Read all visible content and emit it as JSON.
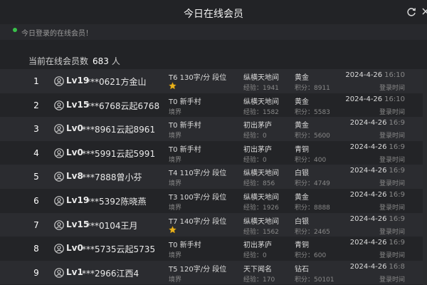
{
  "header": {
    "title": "今日在线会员"
  },
  "notice": {
    "text": "今日登录的在线会员！"
  },
  "summary": {
    "prefix": "当前在线会员数",
    "count": "683",
    "unit": "人"
  },
  "icons": {
    "refresh": "refresh-icon",
    "avatar": "user-avatar-icon",
    "star": "star-icon"
  },
  "colors": {
    "accent": "#39c24a",
    "star": "#e8b21c"
  },
  "members": [
    {
      "rank": "1",
      "level": "Lv19",
      "name": "***0621方金山",
      "speed": "T6 130字/分 段位",
      "sub": "",
      "star": true,
      "realm": "纵横天地间",
      "exp": "经验：1941",
      "tier": "黄金",
      "points": "积分：8911",
      "date": "2024-4-26",
      "time": "16:10",
      "login_label": "登录时间"
    },
    {
      "rank": "2",
      "level": "Lv15",
      "name": "***6768云起6768",
      "speed": "T0 新手村",
      "sub": "境界",
      "star": false,
      "realm": "纵横天地间",
      "exp": "经验：1582",
      "tier": "黄金",
      "points": "积分：5583",
      "date": "2024-4-26",
      "time": "16:10",
      "login_label": "登录时间"
    },
    {
      "rank": "3",
      "level": "Lv0",
      "name": "***8961云起8961",
      "speed": "T0 新手村",
      "sub": "境界",
      "star": false,
      "realm": "初出茅庐",
      "exp": "经验：0",
      "tier": "黄金",
      "points": "积分：5600",
      "date": "2024-4-26",
      "time": "16:9",
      "login_label": "登录时间"
    },
    {
      "rank": "4",
      "level": "Lv0",
      "name": "***5991云起5991",
      "speed": "T0 新手村",
      "sub": "境界",
      "star": false,
      "realm": "初出茅庐",
      "exp": "经验：0",
      "tier": "青铜",
      "points": "积分：400",
      "date": "2024-4-26",
      "time": "16:9",
      "login_label": "登录时间"
    },
    {
      "rank": "5",
      "level": "Lv8",
      "name": "***7888曾小芬",
      "speed": "T4 110字/分 段位",
      "sub": "境界",
      "star": false,
      "realm": "纵横天地间",
      "exp": "经验：856",
      "tier": "白银",
      "points": "积分：4749",
      "date": "2024-4-26",
      "time": "16:9",
      "login_label": "登录时间"
    },
    {
      "rank": "6",
      "level": "Lv19",
      "name": "***5392陈晓燕",
      "speed": "T3 100字/分 段位",
      "sub": "境界",
      "star": false,
      "realm": "纵横天地间",
      "exp": "经验：1926",
      "tier": "黄金",
      "points": "积分：8888",
      "date": "2024-4-26",
      "time": "16:9",
      "login_label": "登录时间"
    },
    {
      "rank": "7",
      "level": "Lv15",
      "name": "***0104王月",
      "speed": "T7 140字/分 段位",
      "sub": "",
      "star": true,
      "realm": "纵横天地间",
      "exp": "经验：1562",
      "tier": "白银",
      "points": "积分：2465",
      "date": "2024-4-26",
      "time": "16:9",
      "login_label": "登录时间"
    },
    {
      "rank": "8",
      "level": "Lv0",
      "name": "***5735云起5735",
      "speed": "T0 新手村",
      "sub": "境界",
      "star": false,
      "realm": "初出茅庐",
      "exp": "经验：0",
      "tier": "青铜",
      "points": "积分：600",
      "date": "2024-4-26",
      "time": "16:9",
      "login_label": "登录时间"
    },
    {
      "rank": "9",
      "level": "Lv1",
      "name": "***2966江西4",
      "speed": "T5 120字/分 段位",
      "sub": "境界",
      "star": false,
      "realm": "天下闻名",
      "exp": "经验：170",
      "tier": "钻石",
      "points": "积分：50101",
      "date": "2024-4-26",
      "time": "16:8",
      "login_label": "登录时间"
    }
  ]
}
